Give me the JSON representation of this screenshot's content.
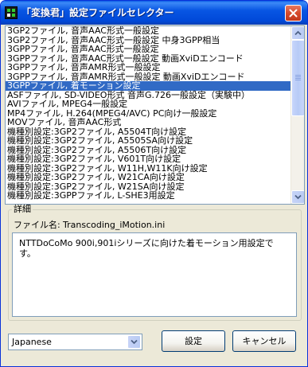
{
  "window": {
    "title": "「変換君」設定ファイルセレクター"
  },
  "list": {
    "items": [
      "3GP2ファイル, 音声AAC形式一般設定",
      "3GP2ファイル, 音声AAC形式一般設定 中身3GPP相当",
      "3GPPファイル, 音声AAC形式一般設定",
      "3GPPファイル, 音声AAC形式一般設定 動画XviDエンコード",
      "3GPPファイル, 音声AMR形式一般設定",
      "3GPPファイル, 音声AMR形式一般設定 動画XviDエンコード",
      "3GPPファイル, 着モーション設定",
      "ASFファイル, SD-VIDEO形式 音声G.726一般設定（実験中）",
      "AVIファイル, MPEG4一般設定",
      "MP4ファイル, H.264(MPEG4/AVC) PC向け一般設定",
      "MOVファイル, 音声AAC形式",
      "機種別設定:3GP2ファイル, A5504T向け設定",
      "機種別設定:3GP2ファイル, A5505SA向け設定",
      "機種別設定:3GP2ファイル, A5506T向け設定",
      "機種別設定:3GP2ファイル, V601T向け設定",
      "機種別設定:3GP2ファイル, W11H,W11K向け設定",
      "機種別設定:3GP2ファイル, W21CA向け設定",
      "機種別設定:3GP2ファイル, W21SA向け設定",
      "機種別設定:3GPPファイル, L-SHE3用設定"
    ],
    "selected_index": 6
  },
  "detail": {
    "legend": "詳細",
    "filename_label": "ファイル名:",
    "filename_value": "Transcoding_iMotion.ini",
    "description": "NTTDoCoMo 900i,901iシリーズに向けた着モーション用設定です。"
  },
  "language": {
    "selected": "Japanese"
  },
  "buttons": {
    "ok": "設定",
    "cancel": "キャンセル"
  },
  "colors": {
    "titlebar": "#0856e3",
    "selection": "#316ac5",
    "window_bg": "#ece9d8",
    "close_button": "#d64a2c"
  },
  "icons": {
    "app": "app-icon",
    "close": "close-icon",
    "scroll_up": "scroll-up-arrow-icon",
    "scroll_down": "scroll-down-arrow-icon",
    "dropdown": "dropdown-arrow-icon"
  }
}
